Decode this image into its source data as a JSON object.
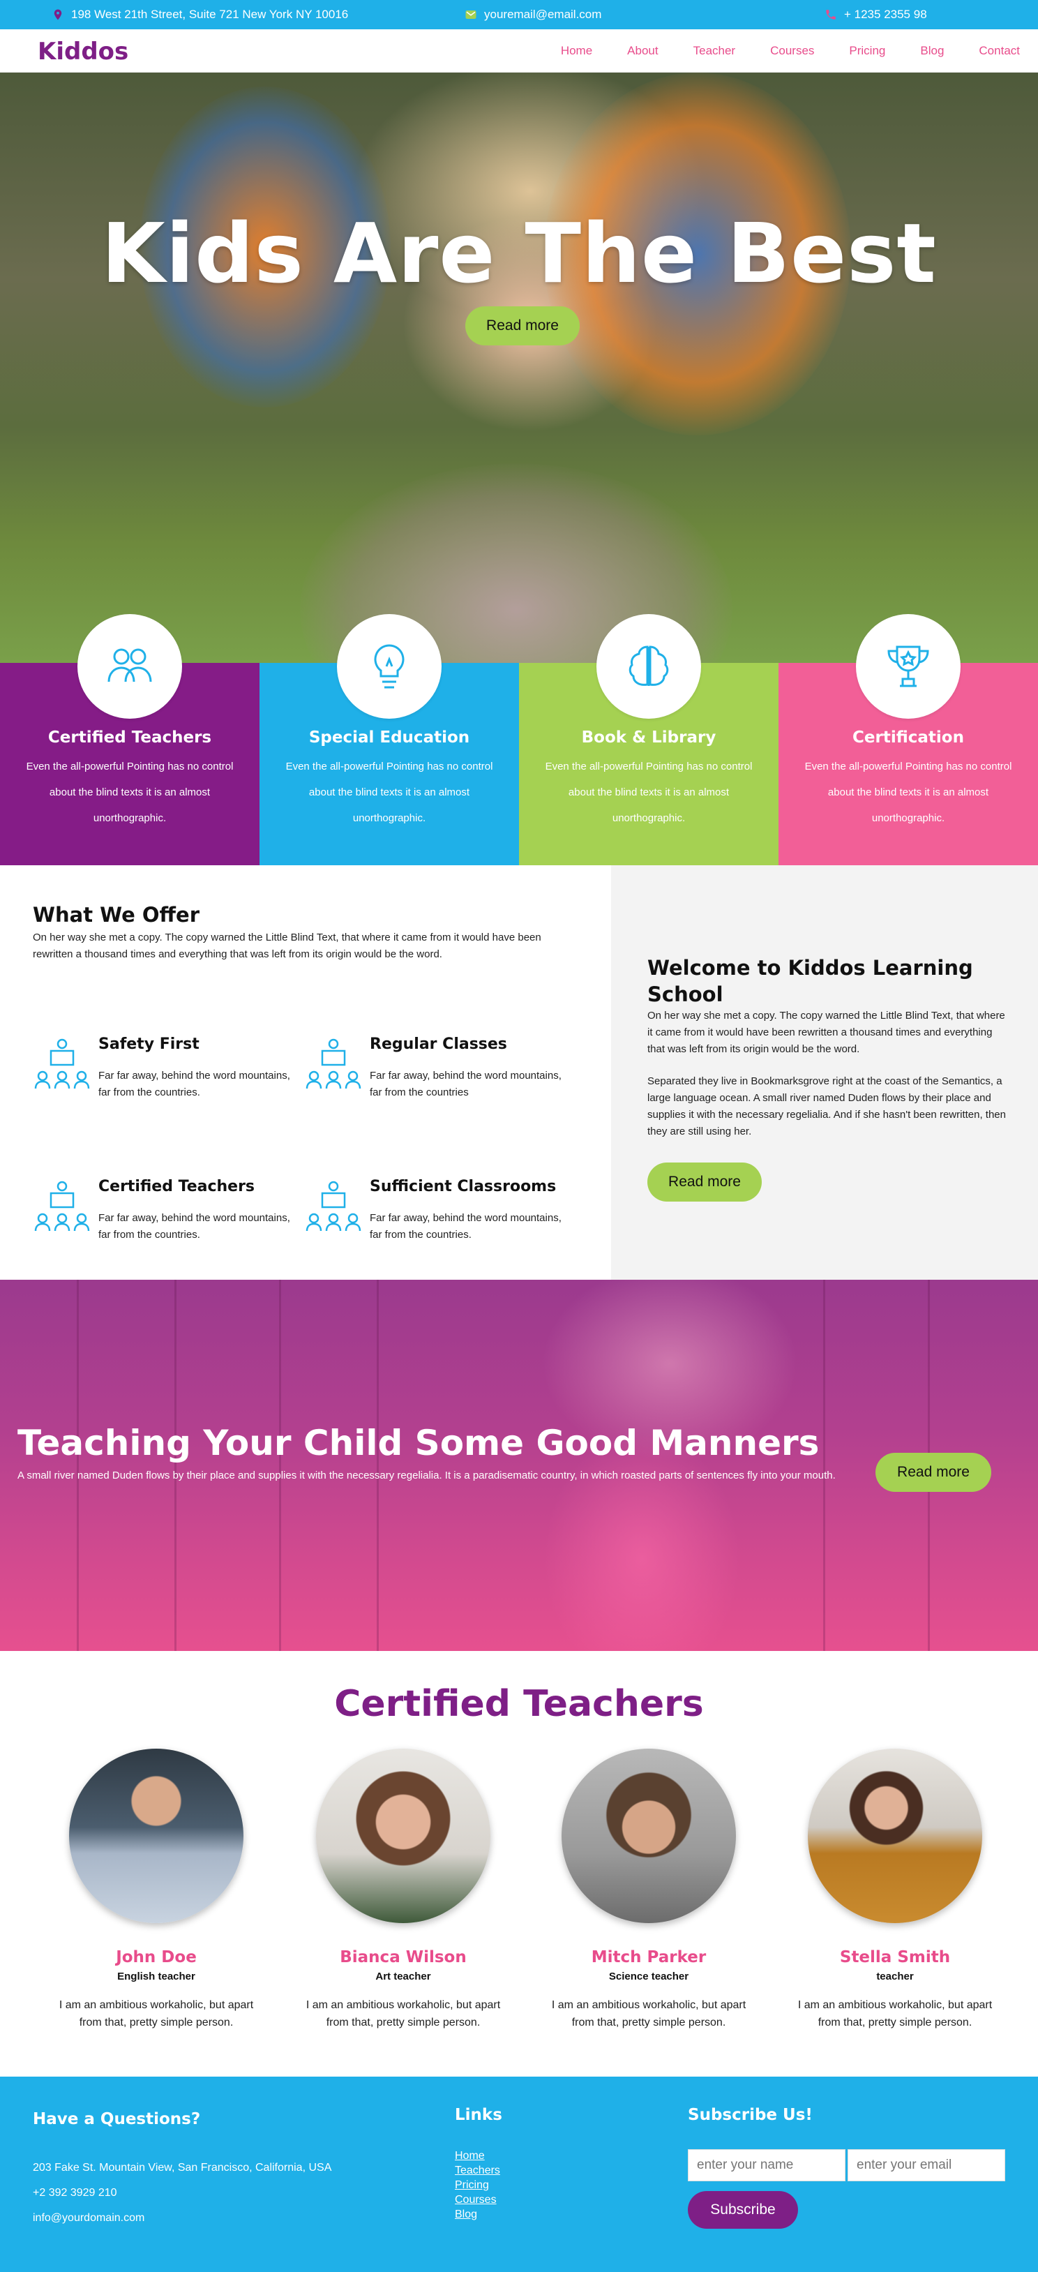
{
  "topbar": {
    "address": "198 West 21th Street, Suite 721 New York NY 10016",
    "email": "youremail@email.com",
    "phone": "+ 1235 2355 98",
    "icons": [
      "location-pin-icon",
      "paper-plane-icon",
      "phone-icon"
    ]
  },
  "nav": {
    "brand": "Kiddos",
    "items": [
      "Home",
      "About",
      "Teacher",
      "Courses",
      "Pricing",
      "Blog",
      "Contact"
    ]
  },
  "hero": {
    "title": "Kids Are The Best",
    "button": "Read more"
  },
  "features": [
    {
      "title": "Certified Teachers",
      "text": "Even the all-powerful Pointing has no control about the blind texts it is an almost unorthographic.",
      "color": "#851c87",
      "icon": "teachers-icon"
    },
    {
      "title": "Special Education",
      "text": "Even the all-powerful Pointing has no control about the blind texts it is an almost unorthographic.",
      "color": "#1fb0e8",
      "icon": "lightbulb-icon"
    },
    {
      "title": "Book & Library",
      "text": "Even the all-powerful Pointing has no control about the blind texts it is an almost unorthographic.",
      "color": "#a5d152",
      "icon": "brain-icon"
    },
    {
      "title": "Certification",
      "text": "Even the all-powerful Pointing has no control about the blind texts it is an almost unorthographic.",
      "color": "#f25f97",
      "icon": "trophy-icon"
    }
  ],
  "offer": {
    "title": "What We Offer",
    "intro": "On her way she met a copy. The copy warned the Little Blind Text, that where it came from it would have been rewritten a thousand times and everything that was left from its origin would be the word.",
    "services": [
      {
        "title": "Safety First",
        "text": "Far far away, behind the word mountains, far from the countries."
      },
      {
        "title": "Regular Classes",
        "text": "Far far away, behind the word mountains, far from the countries"
      },
      {
        "title": "Certified Teachers",
        "text": "Far far away, behind the word mountains, far from the countries."
      },
      {
        "title": "Sufficient Classrooms",
        "text": "Far far away, behind the word mountains, far from the countries."
      }
    ]
  },
  "welcome": {
    "title": "Welcome to Kiddos Learning School",
    "p1": "On her way she met a copy. The copy warned the Little Blind Text, that where it came from it would have been rewritten a thousand times and everything that was left from its origin would be the word.",
    "p2": "Separated they live in Bookmarksgrove right at the coast of the Semantics, a large language ocean. A small river named Duden flows by their place and supplies it with the necessary regelialia. And if she hasn't been rewritten, then they are still using her.",
    "button": "Read more"
  },
  "manners": {
    "title": "Teaching Your Child Some Good Manners",
    "text": "A small river named Duden flows by their place and supplies it with the necessary regelialia. It is a paradisematic country, in which roasted parts of sentences fly into your mouth.",
    "button": "Read more"
  },
  "teachers": {
    "title": "Certified Teachers",
    "list": [
      {
        "name": "John Doe",
        "role": "English teacher",
        "bio": "I am an ambitious workaholic, but apart from that, pretty simple person."
      },
      {
        "name": "Bianca Wilson",
        "role": "Art teacher",
        "bio": "I am an ambitious workaholic, but apart from that, pretty simple person."
      },
      {
        "name": "Mitch Parker",
        "role": "Science teacher",
        "bio": "I am an ambitious workaholic, but apart from that, pretty simple person."
      },
      {
        "name": "Stella Smith",
        "role": "teacher",
        "bio": "I am an ambitious workaholic, but apart from that, pretty simple person."
      }
    ]
  },
  "footer": {
    "questions_title": "Have a Questions?",
    "address": "203 Fake St. Mountain View, San Francisco, California, USA",
    "phone": "+2 392 3929 210",
    "email": "info@yourdomain.com",
    "links_title": "Links",
    "links": [
      "Home",
      "Teachers",
      "Pricing",
      "Courses",
      "Blog"
    ],
    "subscribe_title": "Subscribe Us!",
    "name_placeholder": "enter your name",
    "email_placeholder": "enter your email",
    "subscribe_button": "Subscribe"
  },
  "colors": {
    "brand_purple": "#7e1f86",
    "accent_blue": "#1fb0e8",
    "accent_green": "#a5d152",
    "accent_pink": "#e84c8b"
  }
}
